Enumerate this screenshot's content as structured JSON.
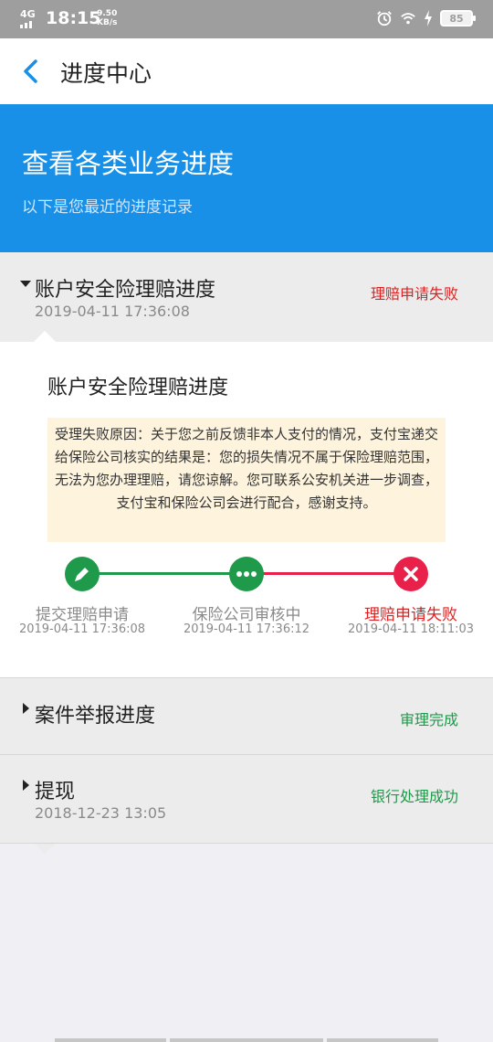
{
  "status_bar": {
    "network": "4G",
    "time": "18:15",
    "speed_value": "9.50",
    "speed_unit": "KB/s",
    "battery": "85"
  },
  "nav": {
    "title": "进度中心"
  },
  "banner": {
    "title": "查看各类业务进度",
    "subtitle": "以下是您最近的进度记录"
  },
  "records": [
    {
      "title": "账户安全险理赔进度",
      "date": "2019-04-11 17:36:08",
      "status": "理赔申请失败",
      "status_color": "#e02020",
      "expanded": true
    },
    {
      "title": "案件举报进度",
      "status": "审理完成",
      "status_color": "#1e9a4a",
      "expanded": false
    },
    {
      "title": "提现",
      "date": "2018-12-23 13:05",
      "status": "银行处理成功",
      "status_color": "#1e9a4a",
      "expanded": false
    }
  ],
  "detail": {
    "title": "账户安全险理赔进度",
    "reason": "受理失败原因：关于您之前反馈非本人支付的情况，支付宝递交给保险公司核实的结果是：您的损失情况不属于保险理赔范围，无法为您办理理赔，请您谅解。您可联系公安机关进一步调查，支付宝和保险公司会进行配合，感谢支持。",
    "steps": [
      {
        "label": "提交理赔申请",
        "date": "2019-04-11 17:36:08",
        "icon": "pencil-icon",
        "color": "#1e9a4a"
      },
      {
        "label": "保险公司审核中",
        "date": "2019-04-11 17:36:12",
        "icon": "dots-icon",
        "color": "#1e9a4a"
      },
      {
        "label": "理赔申请失败",
        "date": "2019-04-11 18:11:03",
        "icon": "close-icon",
        "color": "#e8204a"
      }
    ]
  },
  "colors": {
    "accent_blue": "#1890e8",
    "success_green": "#1e9a4a",
    "fail_red": "#e02020"
  }
}
